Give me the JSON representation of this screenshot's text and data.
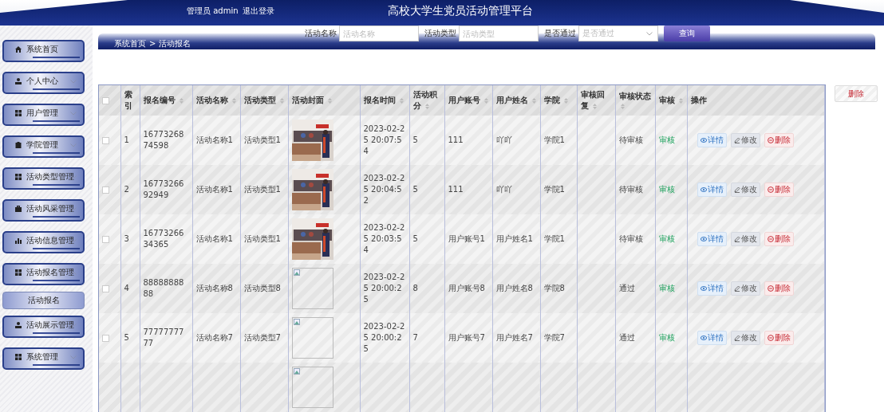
{
  "header": {
    "user": "管理员 admin",
    "logout": "退出登录",
    "title": "高校大学生党员活动管理平台"
  },
  "sidebar": {
    "items": [
      {
        "label": "系统首页",
        "kind": "link"
      },
      {
        "label": "个人中心",
        "kind": "group",
        "expanded": false
      },
      {
        "label": "用户管理",
        "kind": "group",
        "expanded": false
      },
      {
        "label": "学院管理",
        "kind": "group",
        "expanded": false
      },
      {
        "label": "活动类型管理",
        "kind": "group",
        "expanded": false
      },
      {
        "label": "活动风采管理",
        "kind": "group",
        "expanded": false
      },
      {
        "label": "活动信息管理",
        "kind": "group",
        "expanded": false
      },
      {
        "label": "活动报名管理",
        "kind": "group",
        "expanded": true,
        "children": [
          {
            "label": "活动报名"
          }
        ]
      },
      {
        "label": "活动展示管理",
        "kind": "group",
        "expanded": false
      },
      {
        "label": "系统管理",
        "kind": "group",
        "expanded": false
      }
    ]
  },
  "search": {
    "fields": [
      {
        "label": "活动名称",
        "kind": "input",
        "placeholder": "活动名称"
      },
      {
        "label": "活动类型",
        "kind": "input",
        "placeholder": "活动类型"
      },
      {
        "label": "是否通过",
        "kind": "select",
        "placeholder": "是否通过"
      }
    ],
    "button": "查询"
  },
  "breadcrumb": [
    "系统首页",
    ">",
    "活动报名"
  ],
  "delete_button": "删除",
  "table": {
    "all_checked": false,
    "columns": [
      {
        "label": "索引",
        "sortable": false
      },
      {
        "label": "报名编号",
        "sortable": true
      },
      {
        "label": "活动名称",
        "sortable": true
      },
      {
        "label": "活动类型",
        "sortable": true
      },
      {
        "label": "活动封面",
        "sortable": true
      },
      {
        "label": "报名时间",
        "sortable": true
      },
      {
        "label": "活动积分",
        "sortable": true
      },
      {
        "label": "用户账号",
        "sortable": true
      },
      {
        "label": "用户姓名",
        "sortable": true
      },
      {
        "label": "学院",
        "sortable": true
      },
      {
        "label": "审核回复",
        "sortable": true
      },
      {
        "label": "审核状态",
        "sortable": true
      },
      {
        "label": "审核",
        "sortable": true
      },
      {
        "label": "操作",
        "sortable": false
      }
    ],
    "rows": [
      {
        "checked": false,
        "index": "1",
        "number": "1677326874598",
        "name": "活动名称1",
        "type": "活动类型1",
        "time": "2023-02-25 20:07:54",
        "points": "5",
        "account": "111",
        "username": "吖吖",
        "college": "学院1",
        "status": "待审核",
        "audit": "审核",
        "actions": [
          "详情",
          "修改",
          "删除"
        ]
      },
      {
        "checked": false,
        "index": "2",
        "number": "1677326692949",
        "name": "活动名称1",
        "type": "活动类型1",
        "time": "2023-02-25 20:04:52",
        "points": "5",
        "account": "111",
        "username": "吖吖",
        "college": "学院1",
        "status": "待审核",
        "audit": "审核",
        "actions": [
          "详情",
          "修改",
          "删除"
        ]
      },
      {
        "checked": false,
        "index": "3",
        "number": "1677326634365",
        "name": "活动名称1",
        "type": "活动类型1",
        "time": "2023-02-25 20:03:54",
        "points": "5",
        "account": "用户账号1",
        "username": "用户姓名1",
        "college": "学院1",
        "status": "待审核",
        "audit": "审核",
        "actions": [
          "详情",
          "修改",
          "删除"
        ]
      },
      {
        "checked": false,
        "index": "4",
        "number": "8888888888",
        "name": "活动名称8",
        "type": "活动类型8",
        "cover": {
          "kind": "broken_image"
        },
        "time": "2023-02-25 20:00:25",
        "points": "8",
        "account": "用户账号8",
        "username": "用户姓名8",
        "college": "学院8",
        "status": "通过",
        "audit": "审核",
        "actions": [
          "详情",
          "修改",
          "删除"
        ]
      },
      {
        "checked": false,
        "index": "5",
        "number": "7777777777",
        "name": "活动名称7",
        "type": "活动类型7",
        "cover": {
          "kind": "broken_image"
        },
        "time": "2023-02-25 20:00:25",
        "points": "7",
        "account": "用户账号7",
        "username": "用户姓名7",
        "college": "学院7",
        "status": "通过",
        "audit": "审核",
        "actions": [
          "详情",
          "修改",
          "删除"
        ]
      },
      {
        "cover": {
          "kind": "broken_image"
        }
      }
    ]
  }
}
